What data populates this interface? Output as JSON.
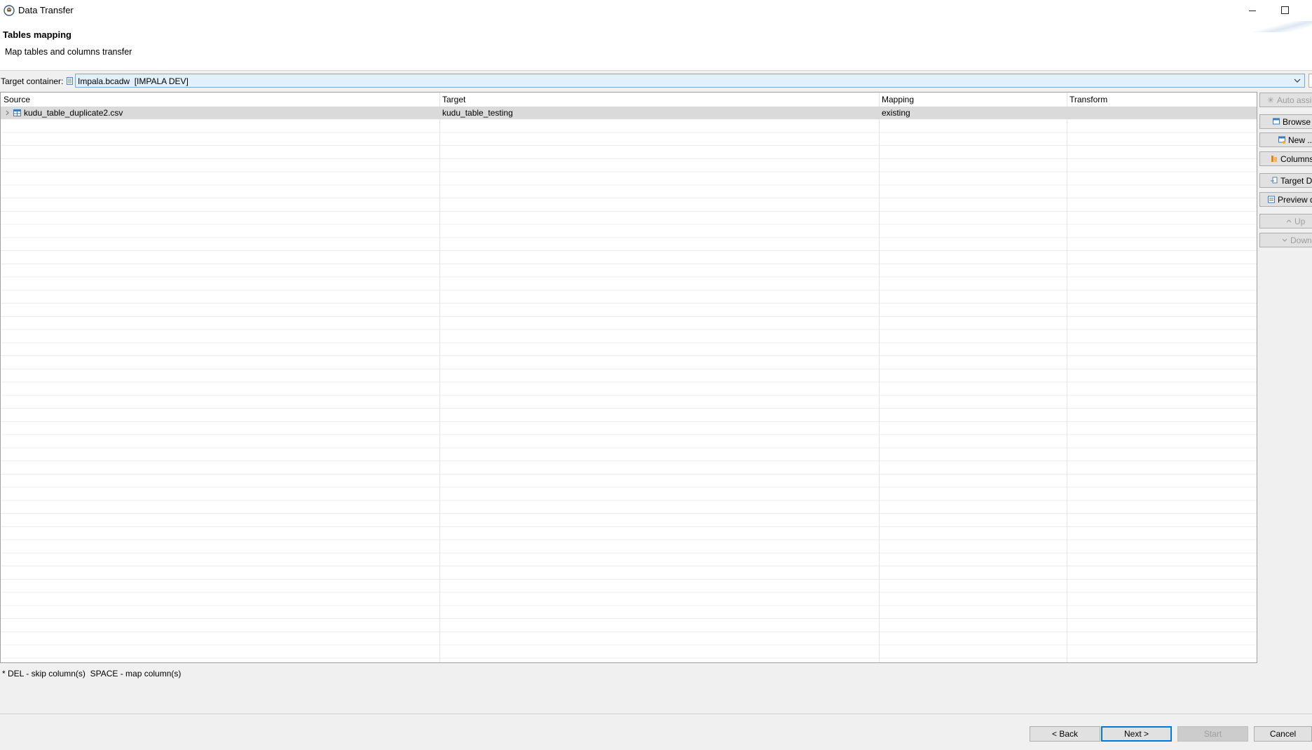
{
  "window": {
    "title": "Data Transfer"
  },
  "header": {
    "title": "Tables mapping",
    "description": "Map tables and columns transfer"
  },
  "target_container": {
    "label": "Target container:",
    "value": "Impala.bcadw  [IMPALA DEV]"
  },
  "grid": {
    "columns": [
      "Source",
      "Target",
      "Mapping",
      "Transform"
    ],
    "rows": [
      {
        "source": "kudu_table_duplicate2.csv",
        "target": "kudu_table_testing",
        "mapping": "existing",
        "transform": ""
      }
    ]
  },
  "side_buttons": {
    "auto_assign": "Auto assi",
    "browse": "Browse",
    "new": "New ...",
    "columns": "Columns",
    "target_ddl": "Target DI",
    "preview": "Preview d",
    "up": "Up",
    "down": "Down"
  },
  "hint": "* DEL - skip column(s)  SPACE - map column(s)",
  "footer": {
    "back": "< Back",
    "next": "Next >",
    "start": "Start",
    "cancel": "Cancel"
  },
  "colors": {
    "accent": "#0078d7",
    "selected_row": "#dadada",
    "combo_bg": "#e3f0fb"
  }
}
